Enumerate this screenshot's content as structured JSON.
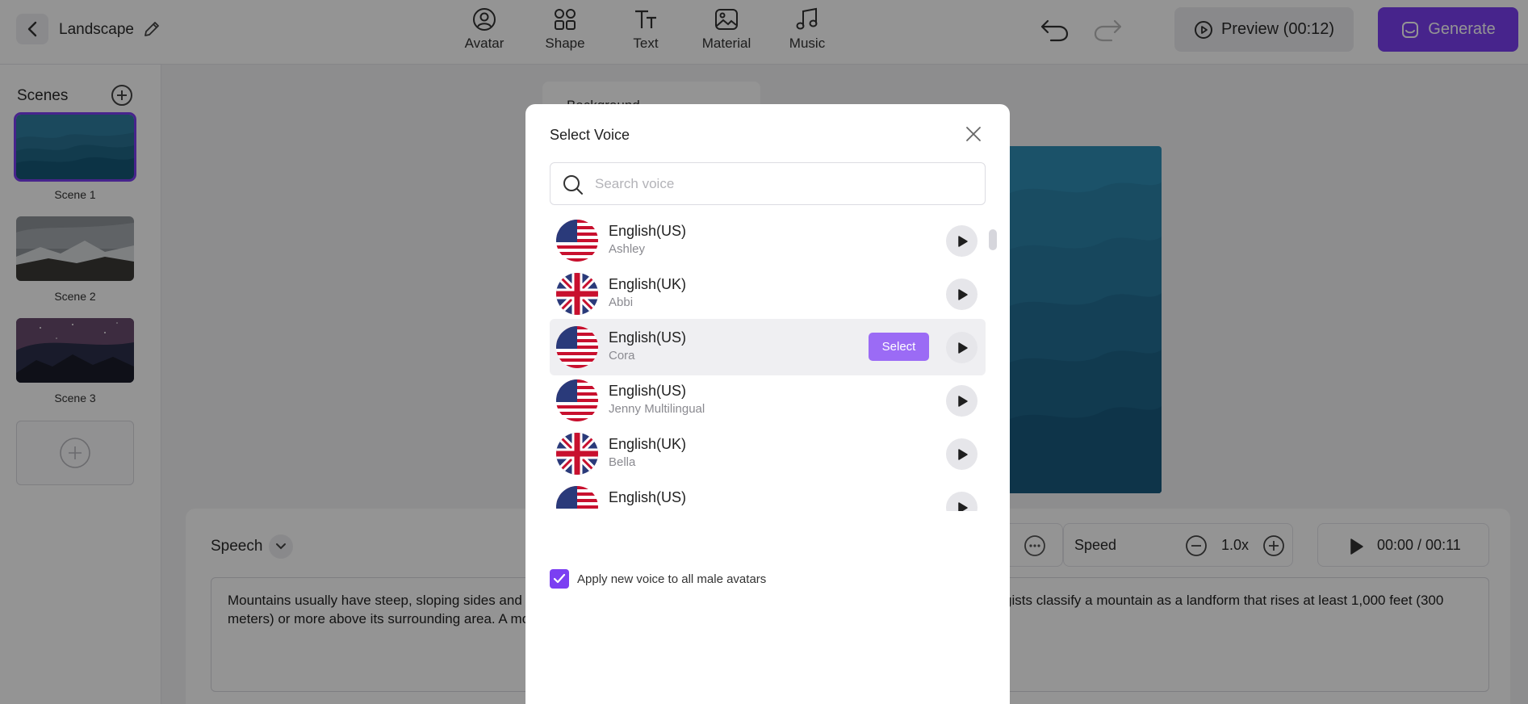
{
  "header": {
    "project_name": "Landscape",
    "tools": [
      {
        "label": "Avatar",
        "icon": "avatar-icon"
      },
      {
        "label": "Shape",
        "icon": "shape-icon"
      },
      {
        "label": "Text",
        "icon": "text-icon"
      },
      {
        "label": "Material",
        "icon": "material-icon"
      },
      {
        "label": "Music",
        "icon": "music-icon"
      }
    ],
    "preview_label": "Preview (00:12)",
    "generate_label": "Generate",
    "colors": {
      "accent": "#7b3ff2"
    }
  },
  "scenes": {
    "title": "Scenes",
    "items": [
      {
        "label": "Scene 1"
      },
      {
        "label": "Scene 2"
      },
      {
        "label": "Scene 3"
      }
    ]
  },
  "canvas": {
    "background_label": "Background"
  },
  "bottom": {
    "speech_label": "Speech",
    "speed_label": "Speed",
    "speed_value": "1.0x",
    "time": "00:00 / 00:11",
    "script_text": "Mountains usually have steep, sloping sides and sharp or rounded ridges, and a high point, called a peak or summit. Most geologists classify a mountain as a landform that rises at least 1,000 feet (300 meters) or more above its surrounding area. A mountain range is a series or chain of mountains that are close together."
  },
  "modal": {
    "title": "Select Voice",
    "search_placeholder": "Search voice",
    "select_label": "Select",
    "voices": [
      {
        "language": "English(US)",
        "name": "Ashley",
        "flag": "us-flag"
      },
      {
        "language": "English(UK)",
        "name": "Abbi",
        "flag": "uk-flag"
      },
      {
        "language": "English(US)",
        "name": "Cora",
        "flag": "us-flag"
      },
      {
        "language": "English(US)",
        "name": "Jenny Multilingual",
        "flag": "us-flag"
      },
      {
        "language": "English(UK)",
        "name": "Bella",
        "flag": "uk-flag"
      },
      {
        "language": "English(US)",
        "name": "",
        "flag": "us-flag"
      }
    ],
    "apply_label": "Apply new voice to all male avatars"
  }
}
